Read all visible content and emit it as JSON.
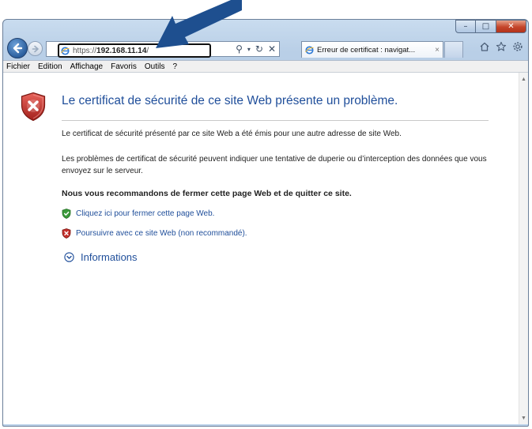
{
  "browser": {
    "address": {
      "scheme": "https://",
      "host": "192.168.11.14",
      "suffix": "/"
    },
    "tab_title": "Erreur de certificat : navigat...",
    "tab_close": "×"
  },
  "window_controls": {
    "minimize": "–",
    "maximize": "□",
    "close": "✕"
  },
  "menu": [
    "Fichier",
    "Edition",
    "Affichage",
    "Favoris",
    "Outils",
    "?"
  ],
  "page": {
    "title": "Le certificat de sécurité de ce site Web présente un problème.",
    "paragraph1": "Le certificat de sécurité présenté par ce site Web a été émis pour une autre adresse de site Web.",
    "paragraph2": "Les problèmes de certificat de sécurité peuvent indiquer une tentative de duperie ou d’interception des données que vous envoyez sur le serveur.",
    "recommendation": "Nous vous recommandons de fermer cette page Web et de quitter ce site.",
    "link_close": "Cliquez ici pour fermer cette page Web.",
    "link_continue": "Poursuivre avec ce site Web (non recommandé).",
    "more_info": "Informations"
  },
  "colors": {
    "title_blue": "#1f4e9a",
    "danger_red": "#c4302b",
    "safe_green": "#3b9a3b",
    "arrow_blue": "#1e4f8f"
  }
}
